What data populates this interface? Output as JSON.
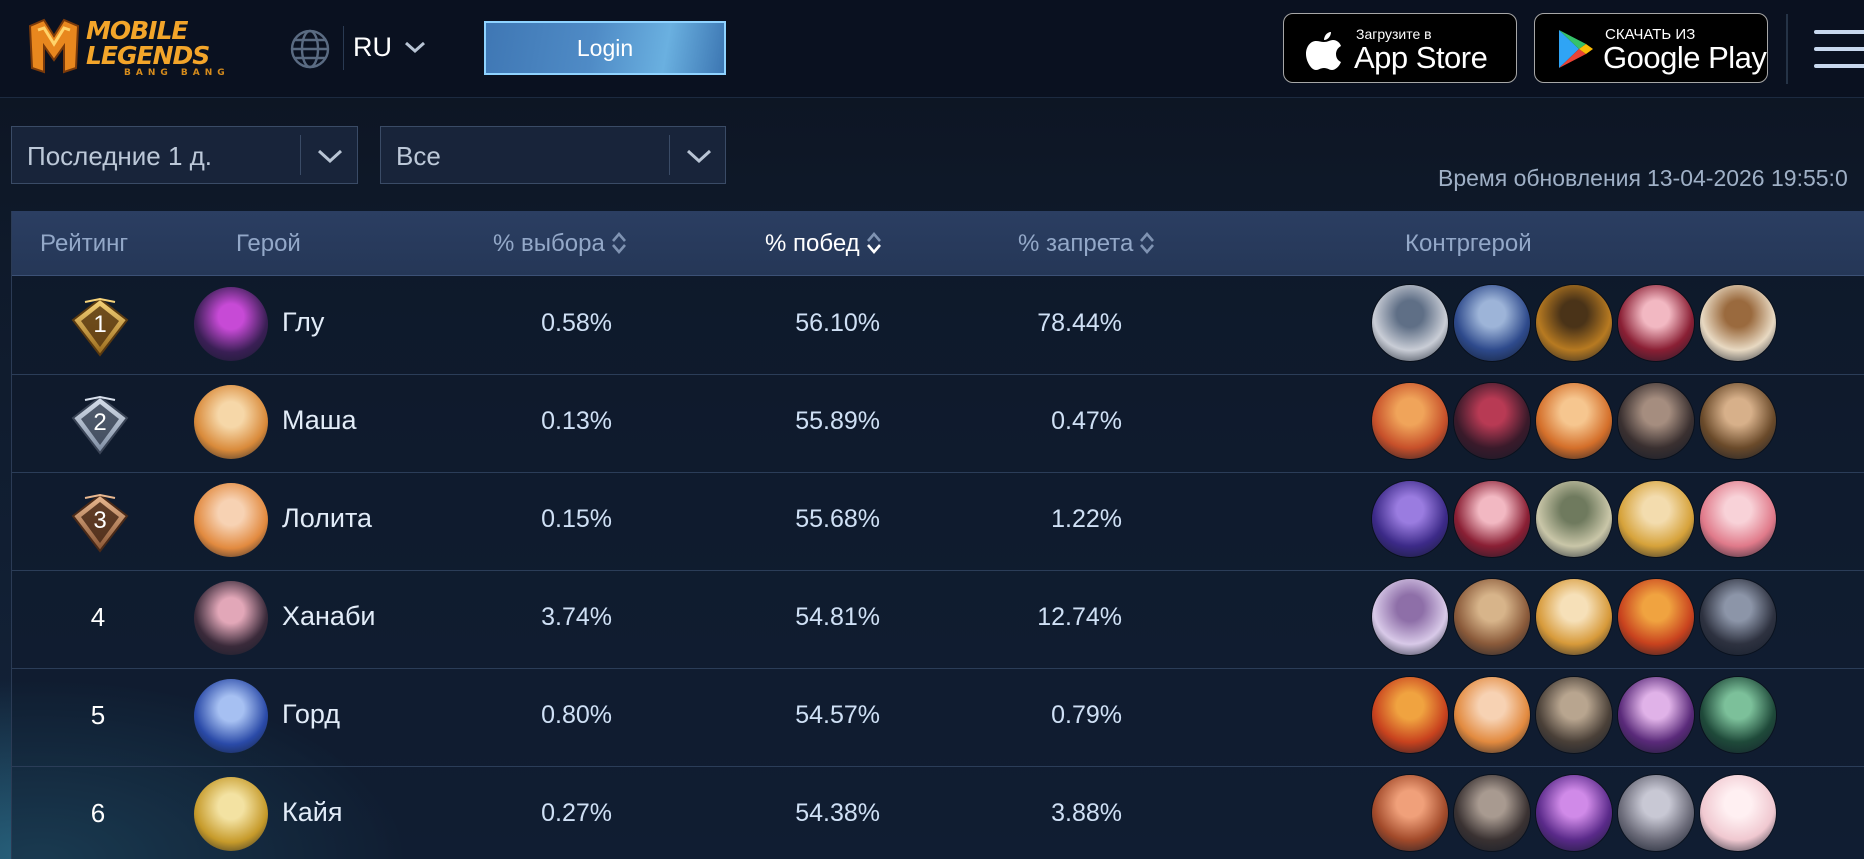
{
  "header": {
    "logo": {
      "line1": "MOBILE",
      "line2": "LEGENDS",
      "line3": "BANG BANG"
    },
    "language": "RU",
    "login_label": "Login",
    "app_store": {
      "small": "Загрузите в",
      "big": "App Store"
    },
    "google_play": {
      "small": "СКАЧАТЬ ИЗ",
      "big": "Google Play"
    }
  },
  "filters": {
    "period": "Последние 1 д.",
    "rank": "Все"
  },
  "update": {
    "label": "Время обновления",
    "time": "13-04-2026 19:55:0"
  },
  "table": {
    "columns": {
      "rank": "Рейтинг",
      "hero": "Герой",
      "pick": "% выбора",
      "win": "% побед",
      "ban": "% запрета",
      "counter": "Контргерой"
    },
    "rows": [
      {
        "rank": "1",
        "name": "Глу",
        "pick": "0.58%",
        "win": "56.10%",
        "ban": "78.44%",
        "avatar": [
          "#3a1f55",
          "#c74ad6"
        ],
        "counters": [
          [
            "#c9cdd6",
            "#5f6f86"
          ],
          [
            "#2e4a8c",
            "#9db4d8"
          ],
          [
            "#b77a21",
            "#4a3318"
          ],
          [
            "#8a1f34",
            "#f2b8c2"
          ],
          [
            "#e8d9c2",
            "#9a6a3e"
          ]
        ]
      },
      {
        "rank": "2",
        "name": "Маша",
        "pick": "0.13%",
        "win": "55.89%",
        "ban": "0.47%",
        "avatar": [
          "#d98a3a",
          "#f6d7a8"
        ],
        "counters": [
          [
            "#c7502a",
            "#f0a45a"
          ],
          [
            "#3a1a2a",
            "#b83a54"
          ],
          [
            "#d46f2a",
            "#f6c68f"
          ],
          [
            "#3a3030",
            "#a58d7f"
          ],
          [
            "#6a4a2a",
            "#d7b08a"
          ]
        ]
      },
      {
        "rank": "3",
        "name": "Лолита",
        "pick": "0.15%",
        "win": "55.68%",
        "ban": "1.22%",
        "avatar": [
          "#e28a3f",
          "#f7d2b3"
        ],
        "counters": [
          [
            "#3c2a88",
            "#9a7ce0"
          ],
          [
            "#8a1f34",
            "#f2b8c2"
          ],
          [
            "#c9c6a8",
            "#6f7a5e"
          ],
          [
            "#d6a23a",
            "#f3dcae"
          ],
          [
            "#e07a8a",
            "#f8d2d8"
          ]
        ]
      },
      {
        "rank": "4",
        "name": "Ханаби",
        "pick": "3.74%",
        "win": "54.81%",
        "ban": "12.74%",
        "avatar": [
          "#3a2a3a",
          "#e2a7b8"
        ],
        "counters": [
          [
            "#d8c9e8",
            "#8e6fa8"
          ],
          [
            "#8a5a3a",
            "#d7b48a"
          ],
          [
            "#d79a3a",
            "#f6e0b8"
          ],
          [
            "#c8421e",
            "#f0a340"
          ],
          [
            "#2e3240",
            "#8c95a8"
          ]
        ]
      },
      {
        "rank": "5",
        "name": "Горд",
        "pick": "0.80%",
        "win": "54.57%",
        "ban": "0.79%",
        "avatar": [
          "#2a4aa8",
          "#a6c0f2"
        ],
        "counters": [
          [
            "#c8421e",
            "#f0a340"
          ],
          [
            "#e28a3f",
            "#f7d2b3"
          ],
          [
            "#4a4038",
            "#b8a58f"
          ],
          [
            "#5a2a7a",
            "#e0b2e8"
          ],
          [
            "#1f4a3a",
            "#7cc09a"
          ]
        ]
      },
      {
        "rank": "6",
        "name": "Кайя",
        "pick": "0.27%",
        "win": "54.38%",
        "ban": "3.88%",
        "avatar": [
          "#c69a2a",
          "#f3e2a2"
        ],
        "counters": [
          [
            "#a24a2a",
            "#f0a07a"
          ],
          [
            "#3a3232",
            "#a89a90"
          ],
          [
            "#5a2a8a",
            "#d08ae8"
          ],
          [
            "#6a6a78",
            "#c8c8d4"
          ],
          [
            "#f0c8d0",
            "#fff0f2"
          ]
        ]
      }
    ]
  }
}
